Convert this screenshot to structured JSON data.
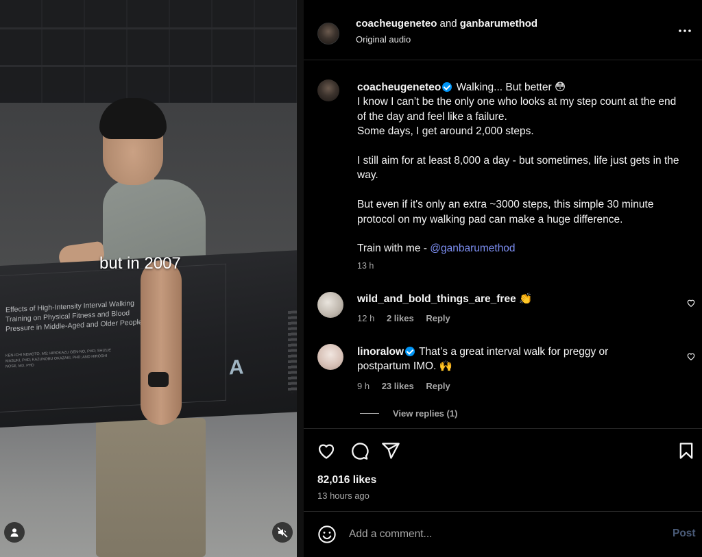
{
  "media": {
    "overlay_caption": "but in 2007",
    "pad_title": "Effects of High-Intensity Interval Walking Training on Physical Fitness and Blood Pressure in Middle-Aged and Older People",
    "pad_authors": "KEN-ICHI NEMOTO, MS; HIROKAZU GEN-NO, PHD; SHIZUE MASUKI, PHD; KAZUNOBU OKAZAKI, PHD; AND HIROSHI NOSE, MD, PHD",
    "pad_logo": "A"
  },
  "header": {
    "user1": "coacheugeneteo",
    "and": "and",
    "user2": "ganbarumethod",
    "audio": "Original audio"
  },
  "caption": {
    "username": "coacheugeneteo",
    "line_title": "Walking... But better 😳",
    "para1": "I know I can’t be the only one who looks at my step count at the end of the day and feel like a failure.",
    "para2": "Some days, I get around 2,000 steps.",
    "para3": "I still aim for at least 8,000 a day - but sometimes, life just gets in the way.",
    "para4": "But even if it's only an extra ~3000 steps, this simple 30 minute protocol on my walking pad can make a huge difference.",
    "train_prefix": "Train with me - ",
    "mention": "@ganbarumethod",
    "time": "13 h"
  },
  "comments": [
    {
      "username": "wild_and_bold_things_are_free",
      "text": "👏",
      "time": "12 h",
      "likes": "2 likes",
      "reply": "Reply"
    },
    {
      "username": "linoralow",
      "text": "That’s a great interval walk for preggy or postpartum IMO. 🙌",
      "time": "9 h",
      "likes": "23 likes",
      "reply": "Reply"
    }
  ],
  "view_replies": "View replies (1)",
  "likes": "82,016 likes",
  "posted_ago": "13 hours ago",
  "add_comment": {
    "placeholder": "Add a comment...",
    "post_label": "Post"
  },
  "colors": {
    "background": "#000000",
    "mention": "#7d8ff3",
    "verified": "#0095f6",
    "muted_text": "#a8a8a8",
    "post_disabled": "#4a5b78"
  }
}
